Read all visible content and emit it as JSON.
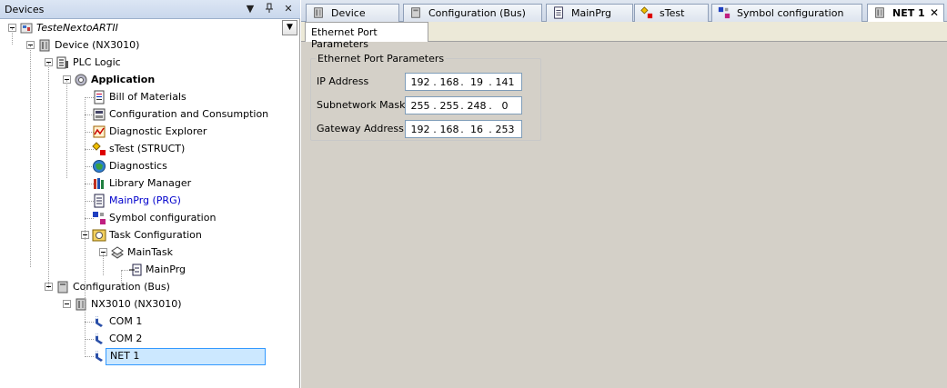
{
  "devices_panel": {
    "title": "Devices",
    "buttons": {
      "dropdown": "▼",
      "pin": "ᚙ",
      "close": "✕"
    }
  },
  "tree": [
    {
      "label": "TesteNextoARTII",
      "icon": "project-icon",
      "italic": true
    },
    {
      "label": "Device (NX3010)",
      "icon": "device-icon"
    },
    {
      "label": "PLC Logic",
      "icon": "plc-logic-icon"
    },
    {
      "label": "Application",
      "icon": "application-gear-icon",
      "bold": true
    },
    {
      "label": "Bill of Materials",
      "icon": "bill-of-materials-icon"
    },
    {
      "label": "Configuration and Consumption",
      "icon": "configuration-consumption-icon"
    },
    {
      "label": "Diagnostic Explorer",
      "icon": "diagnostic-explorer-icon"
    },
    {
      "label": "sTest (STRUCT)",
      "icon": "struct-icon"
    },
    {
      "label": "Diagnostics",
      "icon": "diagnostics-globe-icon"
    },
    {
      "label": "Library Manager",
      "icon": "library-manager-icon"
    },
    {
      "label": "MainPrg (PRG)",
      "icon": "program-icon",
      "blue": true
    },
    {
      "label": "Symbol configuration",
      "icon": "symbol-configuration-icon"
    },
    {
      "label": "Task Configuration",
      "icon": "task-configuration-icon"
    },
    {
      "label": "MainTask",
      "icon": "task-icon"
    },
    {
      "label": "MainPrg",
      "icon": "program-call-icon"
    },
    {
      "label": "Configuration (Bus)",
      "icon": "bus-configuration-icon"
    },
    {
      "label": "NX3010 (NX3010)",
      "icon": "device-icon"
    },
    {
      "label": "COM 1",
      "icon": "com-port-icon"
    },
    {
      "label": "COM 2",
      "icon": "com-port-icon"
    },
    {
      "label": "NET 1",
      "icon": "ethernet-port-icon",
      "selected": true
    }
  ],
  "doc_tabs": [
    {
      "label": "Device",
      "icon": "device-icon"
    },
    {
      "label": "Configuration (Bus)",
      "icon": "bus-configuration-icon"
    },
    {
      "label": "MainPrg",
      "icon": "program-icon"
    },
    {
      "label": "sTest",
      "icon": "struct-icon"
    },
    {
      "label": "Symbol configuration",
      "icon": "symbol-configuration-icon"
    },
    {
      "label": "NET 1",
      "icon": "device-icon",
      "active": true,
      "close": "✕"
    }
  ],
  "inner_tab": {
    "label": "Ethernet Port Parameters"
  },
  "ethernet_params": {
    "group_title": "Ethernet Port Parameters",
    "fields": [
      {
        "label": "IP Address",
        "octets": [
          "192",
          "168",
          "19",
          "141"
        ]
      },
      {
        "label": "Subnetwork Mask",
        "octets": [
          "255",
          "255",
          "248",
          "0"
        ]
      },
      {
        "label": "Gateway Address",
        "octets": [
          "192",
          "168",
          "16",
          "253"
        ]
      }
    ],
    "separator": "."
  },
  "colors": {
    "selection_bg": "#cce8ff",
    "selection_border": "#3399ff",
    "link_blue": "#0000cc",
    "editor_bg": "#d4d0c8"
  }
}
